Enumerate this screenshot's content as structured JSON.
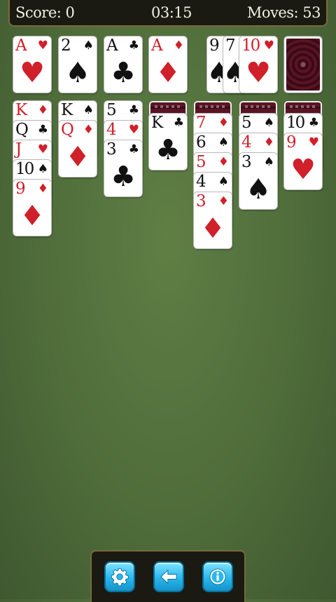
{
  "header": {
    "score_label": "Score: 0",
    "time": "03:15",
    "moves_label": "Moves: 53"
  },
  "foundations": [
    {
      "rank": "A",
      "suit": "♥",
      "color": "red"
    },
    {
      "rank": "2",
      "suit": "♠",
      "color": "black"
    },
    {
      "rank": "A",
      "suit": "♣",
      "color": "black"
    },
    {
      "rank": "A",
      "suit": "♦",
      "color": "red"
    }
  ],
  "waste": [
    {
      "rank": "9",
      "suit": "♠",
      "color": "black"
    },
    {
      "rank": "7",
      "suit": "♠",
      "color": "black"
    },
    {
      "rank": "10",
      "suit": "♥",
      "color": "red"
    }
  ],
  "tableau": [
    {
      "hidden": 0,
      "cards": [
        {
          "rank": "K",
          "suit": "♦",
          "color": "red"
        },
        {
          "rank": "Q",
          "suit": "♣",
          "color": "black"
        },
        {
          "rank": "J",
          "suit": "♥",
          "color": "red"
        },
        {
          "rank": "10",
          "suit": "♠",
          "color": "black"
        },
        {
          "rank": "9",
          "suit": "♦",
          "color": "red"
        }
      ]
    },
    {
      "hidden": 0,
      "cards": [
        {
          "rank": "K",
          "suit": "♠",
          "color": "black"
        },
        {
          "rank": "Q",
          "suit": "♦",
          "color": "red"
        }
      ]
    },
    {
      "hidden": 0,
      "cards": [
        {
          "rank": "5",
          "suit": "♣",
          "color": "black"
        },
        {
          "rank": "4",
          "suit": "♥",
          "color": "red"
        },
        {
          "rank": "3",
          "suit": "♣",
          "color": "black"
        }
      ]
    },
    {
      "hidden": 1,
      "cards": [
        {
          "rank": "K",
          "suit": "♣",
          "color": "black"
        }
      ]
    },
    {
      "hidden": 1,
      "cards": [
        {
          "rank": "7",
          "suit": "♦",
          "color": "red"
        },
        {
          "rank": "6",
          "suit": "♠",
          "color": "black"
        },
        {
          "rank": "5",
          "suit": "♦",
          "color": "red"
        },
        {
          "rank": "4",
          "suit": "♠",
          "color": "black"
        },
        {
          "rank": "3",
          "suit": "♦",
          "color": "red"
        }
      ]
    },
    {
      "hidden": 1,
      "cards": [
        {
          "rank": "5",
          "suit": "♠",
          "color": "black"
        },
        {
          "rank": "4",
          "suit": "♦",
          "color": "red"
        },
        {
          "rank": "3",
          "suit": "♠",
          "color": "black"
        }
      ]
    },
    {
      "hidden": 1,
      "cards": [
        {
          "rank": "10",
          "suit": "♣",
          "color": "black"
        },
        {
          "rank": "9",
          "suit": "♥",
          "color": "red"
        }
      ]
    }
  ],
  "toolbar": {
    "buttons": [
      "settings-icon",
      "back-arrow-icon",
      "info-icon"
    ]
  },
  "colors": {
    "felt": "#52703c",
    "red_suit": "#d0202a",
    "button": "#29b8ec"
  }
}
